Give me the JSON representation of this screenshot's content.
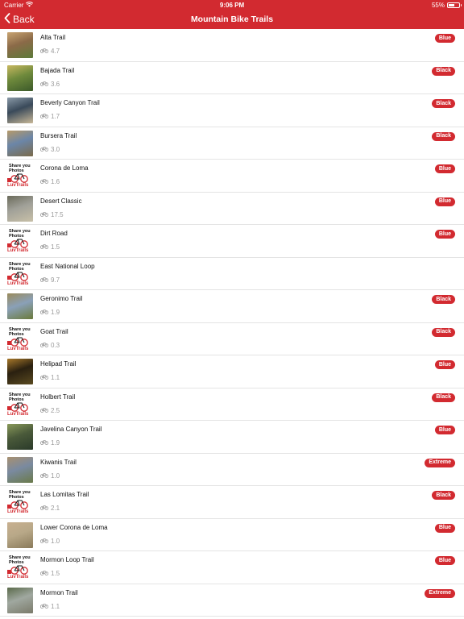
{
  "status_bar": {
    "carrier": "Carrier",
    "time": "9:06 PM",
    "battery": "55%",
    "battery_level": 0.55
  },
  "nav": {
    "back_label": "Back",
    "title": "Mountain Bike Trails"
  },
  "colors": {
    "brand": "#d22a30"
  },
  "trails": [
    {
      "name": "Alta Trail",
      "distance": "4.7",
      "difficulty": "Blue",
      "thumb": "photo",
      "thumb_colors": [
        "#8b6a48",
        "#c9a472",
        "#5d7a3a"
      ]
    },
    {
      "name": "Bajada Trail",
      "distance": "3.6",
      "difficulty": "Black",
      "thumb": "photo",
      "thumb_colors": [
        "#6f8a3c",
        "#c8b860",
        "#3c5a2a"
      ]
    },
    {
      "name": "Beverly Canyon Trail",
      "distance": "1.7",
      "difficulty": "Black",
      "thumb": "photo",
      "thumb_colors": [
        "#3a4a5a",
        "#8a9aa8",
        "#c8b898"
      ]
    },
    {
      "name": "Bursera Trail",
      "distance": "3.0",
      "difficulty": "Black",
      "thumb": "photo",
      "thumb_colors": [
        "#6b86a8",
        "#b89a68",
        "#7a6a4a"
      ]
    },
    {
      "name": "Corona de Loma",
      "distance": "1.6",
      "difficulty": "Blue",
      "thumb": "placeholder"
    },
    {
      "name": "Desert Classic",
      "distance": "17.5",
      "difficulty": "Blue",
      "thumb": "photo",
      "thumb_colors": [
        "#a0a098",
        "#6a6a5a",
        "#c8c0a8"
      ]
    },
    {
      "name": "Dirt Road",
      "distance": "1.5",
      "difficulty": "Blue",
      "thumb": "placeholder"
    },
    {
      "name": "East National Loop",
      "distance": "9.7",
      "difficulty": "",
      "thumb": "placeholder"
    },
    {
      "name": "Geronimo Trail",
      "distance": "1.9",
      "difficulty": "Black",
      "thumb": "photo",
      "thumb_colors": [
        "#8aa0b8",
        "#9a8a5a",
        "#6a7a3a"
      ]
    },
    {
      "name": "Goat Trail",
      "distance": "0.3",
      "difficulty": "Black",
      "thumb": "placeholder"
    },
    {
      "name": "Helipad Trail",
      "distance": "1.1",
      "difficulty": "Blue",
      "thumb": "photo",
      "thumb_colors": [
        "#2a2010",
        "#a8782a",
        "#5a4a20"
      ]
    },
    {
      "name": "Holbert Trail",
      "distance": "2.5",
      "difficulty": "Black",
      "thumb": "placeholder"
    },
    {
      "name": "Javelina Canyon Trail",
      "distance": "1.9",
      "difficulty": "Blue",
      "thumb": "photo",
      "thumb_colors": [
        "#4a5a3a",
        "#8a9a5a",
        "#2a3a2a"
      ]
    },
    {
      "name": "Kiwanis Trail",
      "distance": "1.0",
      "difficulty": "Extreme",
      "thumb": "photo",
      "thumb_colors": [
        "#7a8aa0",
        "#a89070",
        "#6a7a4a"
      ]
    },
    {
      "name": "Las Lomitas Trail",
      "distance": "2.1",
      "difficulty": "Black",
      "thumb": "placeholder"
    },
    {
      "name": "Lower Corona de Loma",
      "distance": "1.0",
      "difficulty": "Blue",
      "thumb": "photo",
      "thumb_colors": [
        "#b8a888",
        "#c8b090",
        "#8a7a5a"
      ]
    },
    {
      "name": "Mormon Loop Trail",
      "distance": "1.5",
      "difficulty": "Blue",
      "thumb": "placeholder"
    },
    {
      "name": "Mormon Trail",
      "distance": "1.1",
      "difficulty": "Extreme",
      "thumb": "photo",
      "thumb_colors": [
        "#a0a8a0",
        "#5a6a4a",
        "#7a7a6a"
      ]
    }
  ],
  "placeholder_thumb": {
    "line1": "Share you",
    "line2": "Photos",
    "brand": "LuvTrails"
  }
}
